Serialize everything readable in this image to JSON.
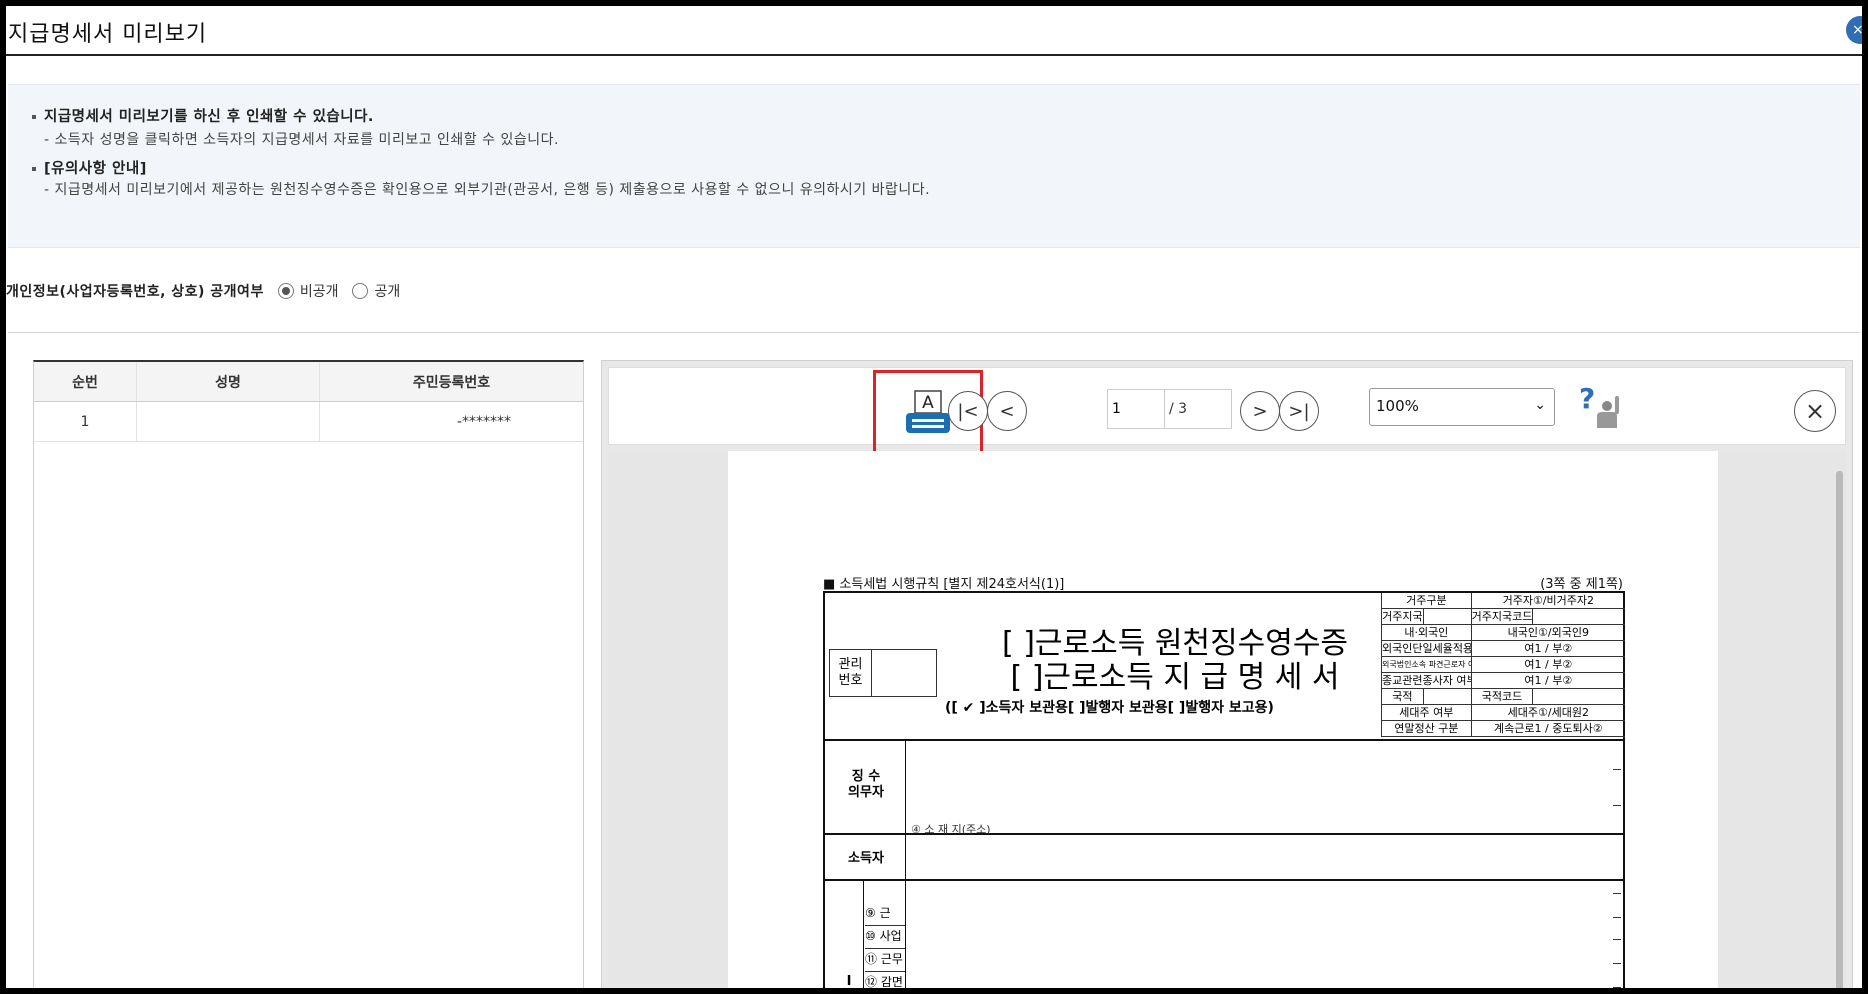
{
  "title": "지급명세서 미리보기",
  "info": {
    "line1": "지급명세서 미리보기를 하신 후 인쇄할 수 있습니다.",
    "line1_sub": "- 소득자 성명을 클릭하면 소득자의 지급명세서 자료를 미리보고 인쇄할 수 있습니다.",
    "line2": "[유의사항 안내]",
    "line2_sub": "- 지급명세서 미리보기에서 제공하는 원천징수영수증은 확인용으로 외부기관(관공서, 은행 등) 제출용으로 사용할 수 없으니 유의하시기 바랍니다."
  },
  "privacy": {
    "label": "개인정보(사업자등록번호, 상호) 공개여부",
    "options": [
      "비공개",
      "공개"
    ],
    "selected": "비공개"
  },
  "table": {
    "headers": [
      "순번",
      "성명",
      "주민등록번호"
    ],
    "rows": [
      {
        "no": "1",
        "name": "",
        "rrn": "-*******"
      }
    ]
  },
  "viewer": {
    "page_current": "1",
    "page_total": "/ 3",
    "zoom": "100%",
    "print_icon_letter": "A",
    "icons": [
      "print-icon",
      "first-page-icon",
      "prev-page-icon",
      "next-page-icon",
      "last-page-icon",
      "help-icon",
      "close-icon"
    ],
    "highlight_color": "#d9252a",
    "accent_color": "#1a6fb3"
  },
  "form": {
    "rule": "■ 소득세법 시행규칙 [별지 제24호서식(1)]",
    "page_note": "(3쪽 중 제1쪽)",
    "mgmt_label": "관리\n번호",
    "title_line1": "[  ]근로소득 원천징수영수증",
    "title_line2": "[  ]근로소득 지 급 명 세 서",
    "subtitle": "([ ✔ ]소득자 보관용[     ]발행자 보관용[     ]발행자 보고용)",
    "grid": [
      [
        "거주구분",
        "거주자①/비거주자2"
      ],
      [
        "거주지국",
        "",
        "거주지국코드",
        ""
      ],
      [
        "내·외국인",
        "내국인①/외국인9"
      ],
      [
        "외국인단일세율적용",
        "여1 / 부②"
      ],
      [
        "외국법인소속 파견근로자 여부",
        "여1 / 부②"
      ],
      [
        "종교관련종사자 여부",
        "여1 / 부②"
      ],
      [
        "국적",
        "",
        "국적코드",
        ""
      ],
      [
        "세대주 여부",
        "세대주①/세대원2"
      ],
      [
        "연말정산 구분",
        "계속근로1 / 중도퇴사②"
      ]
    ],
    "payer_label": "징 수\n의무자",
    "earner_label": "소득자",
    "side_label": "Ⅰ\n근",
    "partial_text": "④ 소 재 지(주소)",
    "items": [
      "⑨ 근",
      "⑩ 사업",
      "⑪ 근무",
      "⑫ 감면"
    ]
  }
}
